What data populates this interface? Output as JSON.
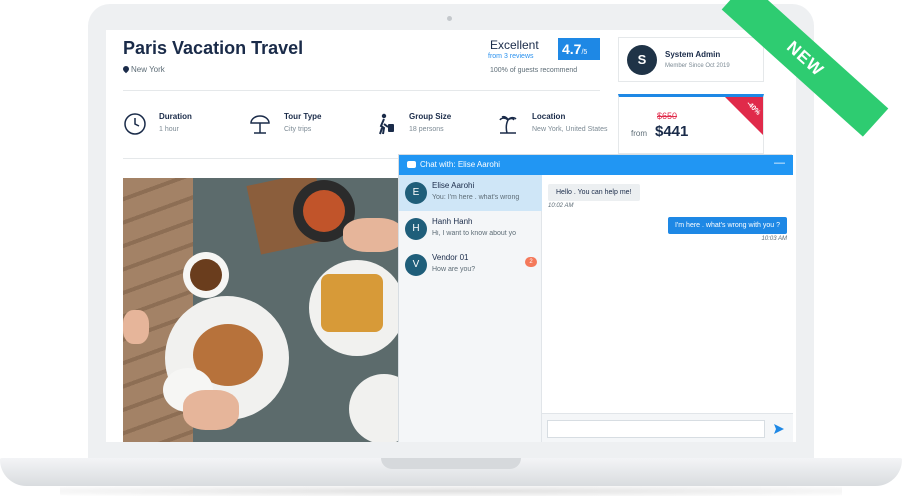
{
  "listing": {
    "title": "Paris Vacation Travel",
    "location": "New York",
    "rating_word": "Excellent",
    "reviews_link": "from 3 reviews",
    "score": "4.7",
    "score_suffix": "/5",
    "recommend_text": "100% of guests recommend"
  },
  "features": [
    {
      "label": "Duration",
      "value": "1 hour",
      "icon": "clock-icon"
    },
    {
      "label": "Tour Type",
      "value": "City trips",
      "icon": "beach-umbrella-icon"
    },
    {
      "label": "Group Size",
      "value": "18 persons",
      "icon": "traveler-icon"
    },
    {
      "label": "Location",
      "value": "New York, United States",
      "icon": "palm-island-icon"
    }
  ],
  "owner": {
    "avatar_letter": "S",
    "name": "System Admin",
    "member_since": "Member Since Oct 2019"
  },
  "price": {
    "old": "$650",
    "from_label": "from",
    "current": "$441",
    "sale_badge": "-40%"
  },
  "ribbon": {
    "text": "NEW"
  },
  "chat": {
    "header_prefix": "Chat with:",
    "header_name": "Elise Aarohi",
    "minimize": "—",
    "contacts": [
      {
        "letter": "E",
        "name": "Elise Aarohi",
        "preview": "You: I'm here . what's wrong",
        "unread": ""
      },
      {
        "letter": "H",
        "name": "Hanh Hanh",
        "preview": "Hi, I want to know about yo",
        "unread": ""
      },
      {
        "letter": "V",
        "name": "Vendor 01",
        "preview": "How are you?",
        "unread": "2"
      }
    ],
    "messages": {
      "incoming_text": "Hello . You can help me!",
      "incoming_time": "10:02 AM",
      "outgoing_text": "I'm here . what's wrong with you ?",
      "outgoing_time": "10:03 AM"
    },
    "input_placeholder": ""
  },
  "colors": {
    "accent": "#1e88e5",
    "ribbon": "#2ecc71",
    "sale": "#e02a4a",
    "dark": "#1a2b49"
  }
}
